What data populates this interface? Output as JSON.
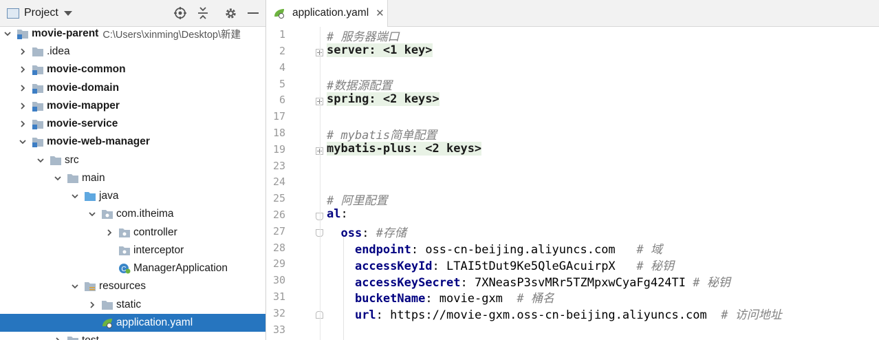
{
  "project_panel": {
    "title": "Project",
    "dropdown_icon": "chevron-down-icon",
    "toolbar_icons": [
      "locate-icon",
      "collapse-icon",
      "gear-icon",
      "minimize-icon"
    ],
    "tree": [
      {
        "label": "movie-parent",
        "path": "C:\\Users\\xinming\\Desktop\\新建",
        "bold": true,
        "expanded": true,
        "level": 0
      },
      {
        "label": ".idea",
        "bold": false,
        "expanded": false,
        "level": 1
      },
      {
        "label": "movie-common",
        "bold": true,
        "expanded": false,
        "level": 1
      },
      {
        "label": "movie-domain",
        "bold": true,
        "expanded": false,
        "level": 1
      },
      {
        "label": "movie-mapper",
        "bold": true,
        "expanded": false,
        "level": 1
      },
      {
        "label": "movie-service",
        "bold": true,
        "expanded": false,
        "level": 1
      },
      {
        "label": "movie-web-manager",
        "bold": true,
        "expanded": true,
        "level": 1
      },
      {
        "label": "src",
        "bold": false,
        "expanded": true,
        "level": 2
      },
      {
        "label": "main",
        "bold": false,
        "expanded": true,
        "level": 3
      },
      {
        "label": "java",
        "bold": false,
        "expanded": true,
        "level": 4
      },
      {
        "label": "com.itheima",
        "bold": false,
        "expanded": true,
        "level": 5
      },
      {
        "label": "controller",
        "bold": false,
        "expanded": false,
        "level": 6
      },
      {
        "label": "interceptor",
        "bold": false,
        "level": 6
      },
      {
        "label": "ManagerApplication",
        "bold": false,
        "level": 6
      },
      {
        "label": "resources",
        "bold": false,
        "expanded": true,
        "level": 4
      },
      {
        "label": "static",
        "bold": false,
        "expanded": false,
        "level": 5
      },
      {
        "label": "application.yaml",
        "bold": false,
        "level": 5,
        "selected": true
      },
      {
        "label": "test",
        "bold": false,
        "expanded": false,
        "level": 3
      }
    ]
  },
  "editor": {
    "tab_label": "application.yaml",
    "line_numbers": [
      "1",
      "2",
      "4",
      "5",
      "6",
      "17",
      "18",
      "19",
      "23",
      "24",
      "25",
      "26",
      "27",
      "28",
      "29",
      "30",
      "31",
      "32",
      "33"
    ],
    "lines": {
      "l1_comment": "# 服务器端口",
      "l2_fold": "server: <1 key>",
      "l5_comment": "#数据源配置",
      "l6_fold": "spring: <2 keys>",
      "l18_comment": "# mybatis简单配置",
      "l19_fold": "mybatis-plus: <2 keys>",
      "l25_comment": "# 阿里配置",
      "l26_key": "al",
      "l27_key": "oss",
      "l27_comment": "#存储",
      "l28_key": "endpoint",
      "l28_value": "oss-cn-beijing.aliyuncs.com",
      "l28_comment": "# 域",
      "l29_key": "accessKeyId",
      "l29_value": "LTAI5tDut9Ke5QleGAcuirpX",
      "l29_comment": "# 秘钥",
      "l30_key": "accessKeySecret",
      "l30_value": "7XNeasP3svMRr5TZMpxwCyaFg424TI",
      "l30_comment": "# 秘钥",
      "l31_key": "bucketName",
      "l31_value": "movie-gxm",
      "l31_comment": "# 桶名",
      "l32_key": "url",
      "l32_value": "https://movie-gxm.oss-cn-beijing.aliyuncs.com",
      "l32_comment": "# 访问地址"
    },
    "colors": {
      "selection": "#2675bf",
      "fold_bg": "#e8f2e5",
      "key": "#000080",
      "comment": "#808080"
    }
  }
}
